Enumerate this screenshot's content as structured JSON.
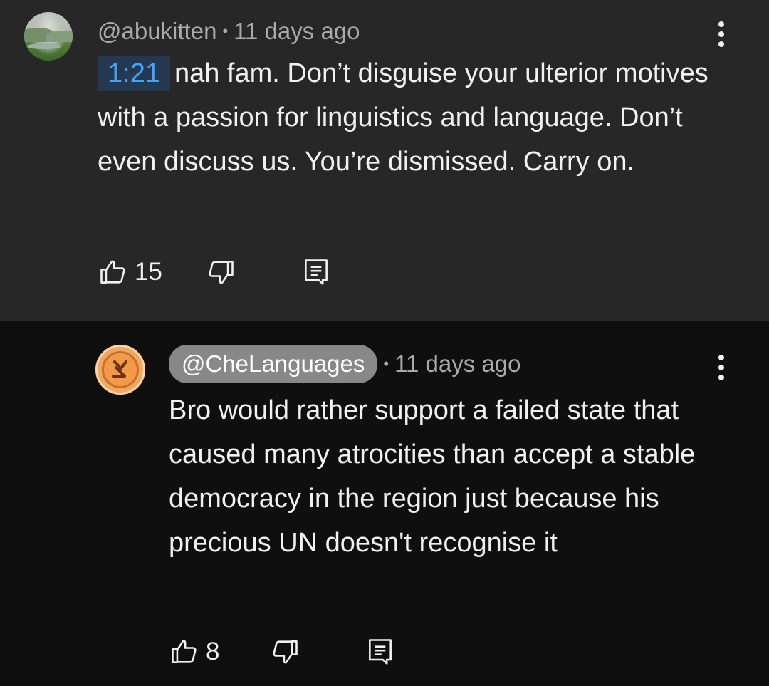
{
  "comments": [
    {
      "author": "@abukitten",
      "time_ago": "11 days ago",
      "timestamp_link": "1:21",
      "text": "nah fam. Don’t disguise your ulterior motives with a passion for linguistics and language. Don’t even discuss us. You’re dismissed. Carry on.",
      "likes": "15",
      "avatar_icon": "landscape-avatar"
    },
    {
      "author": "@CheLanguages",
      "time_ago": "11 days ago",
      "text": "Bro would rather support a failed state that caused many atrocities than accept a stable democracy in the region just because his precious UN doesn't recognise it",
      "likes": "8",
      "avatar_icon": "che-logo-avatar",
      "author_highlighted": true
    }
  ],
  "separator": "•",
  "icons": {
    "like": "thumbs-up-icon",
    "dislike": "thumbs-down-icon",
    "reply": "reply-comment-icon",
    "more": "more-vert-icon"
  },
  "colors": {
    "timestamp_link": "#3ea6ff",
    "timestamp_bg": "#263850",
    "author_chip_bg": "#888888",
    "avatar_orange": "#f0a860",
    "bg_highlight": "#272727",
    "bg_dark": "#0f0f0f"
  }
}
